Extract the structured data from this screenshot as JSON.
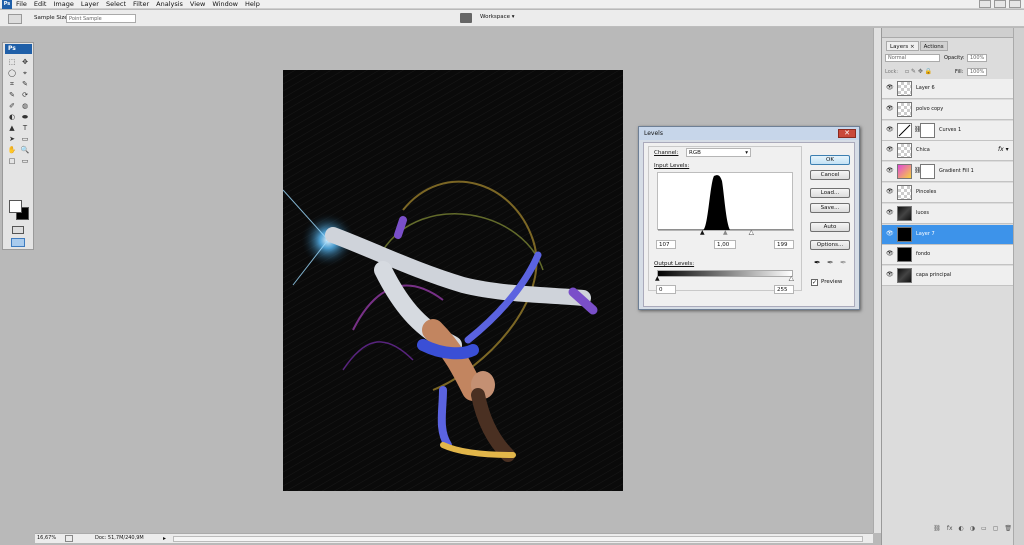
{
  "app": {
    "logo": "Ps"
  },
  "menus": [
    "File",
    "Edit",
    "Image",
    "Layer",
    "Select",
    "Filter",
    "Analysis",
    "View",
    "Window",
    "Help"
  ],
  "options": {
    "sample_size_label": "Sample Size:",
    "sample_size_value": "Point Sample",
    "workspace_label": "Workspace ▾"
  },
  "toolbox": {
    "title": "Ps",
    "glyphs": [
      "⬚",
      "✥",
      "◯",
      "⌖",
      "⌗",
      "✎",
      "✎",
      "⟳",
      "✐",
      "◍",
      "◐",
      "⬬",
      "▲",
      "T",
      "➤",
      "▭",
      "✋",
      "🔍",
      "□",
      "▭"
    ]
  },
  "status": {
    "zoom": "16,67%",
    "doc": "Doc: 51,7M/240,9M"
  },
  "levels": {
    "title": "Levels",
    "close": "✕",
    "channel_label": "Channel:",
    "channel_value": "RGB",
    "input_label": "Input Levels:",
    "input_black": "107",
    "input_gamma": "1,00",
    "input_white": "199",
    "output_label": "Output Levels:",
    "output_black": "0",
    "output_white": "255",
    "buttons": {
      "ok": "OK",
      "cancel": "Cancel",
      "load": "Load...",
      "save": "Save...",
      "auto": "Auto",
      "options": "Options..."
    },
    "preview_label": "Preview",
    "preview_checked": true
  },
  "layers_panel": {
    "tabs": [
      "Layers ×",
      "Actions"
    ],
    "blend_mode": "Normal",
    "opacity_label": "Opacity:",
    "opacity_value": "100%",
    "lock_label": "Lock:",
    "fill_label": "Fill:",
    "fill_value": "100%",
    "layers": [
      {
        "name": "Layer 6",
        "selected": false,
        "thumb": "transparent"
      },
      {
        "name": "polvo copy",
        "selected": false,
        "thumb": "transparent"
      },
      {
        "name": "Curves 1",
        "selected": false,
        "thumb": "curves"
      },
      {
        "name": "Chica",
        "selected": false,
        "thumb": "transparent",
        "fx": "fx ▾"
      },
      {
        "name": "Gradient Fill 1",
        "selected": false,
        "thumb": "gradient"
      },
      {
        "name": "Pinceles",
        "selected": false,
        "thumb": "transparent"
      },
      {
        "name": "luces",
        "selected": false,
        "thumb": "dark"
      },
      {
        "name": "Layer 7",
        "selected": true,
        "thumb": "black"
      },
      {
        "name": "fondo",
        "selected": false,
        "thumb": "black"
      },
      {
        "name": "capa principal",
        "selected": false,
        "thumb": "dark"
      }
    ],
    "bottom_icons": [
      "⛓",
      "fx",
      "◐",
      "◑",
      "▭",
      "▢",
      "🗑"
    ]
  },
  "colors": {
    "accent": "#3d93ea",
    "title_blue": "#1f5fa8",
    "close_red": "#c9483a"
  }
}
